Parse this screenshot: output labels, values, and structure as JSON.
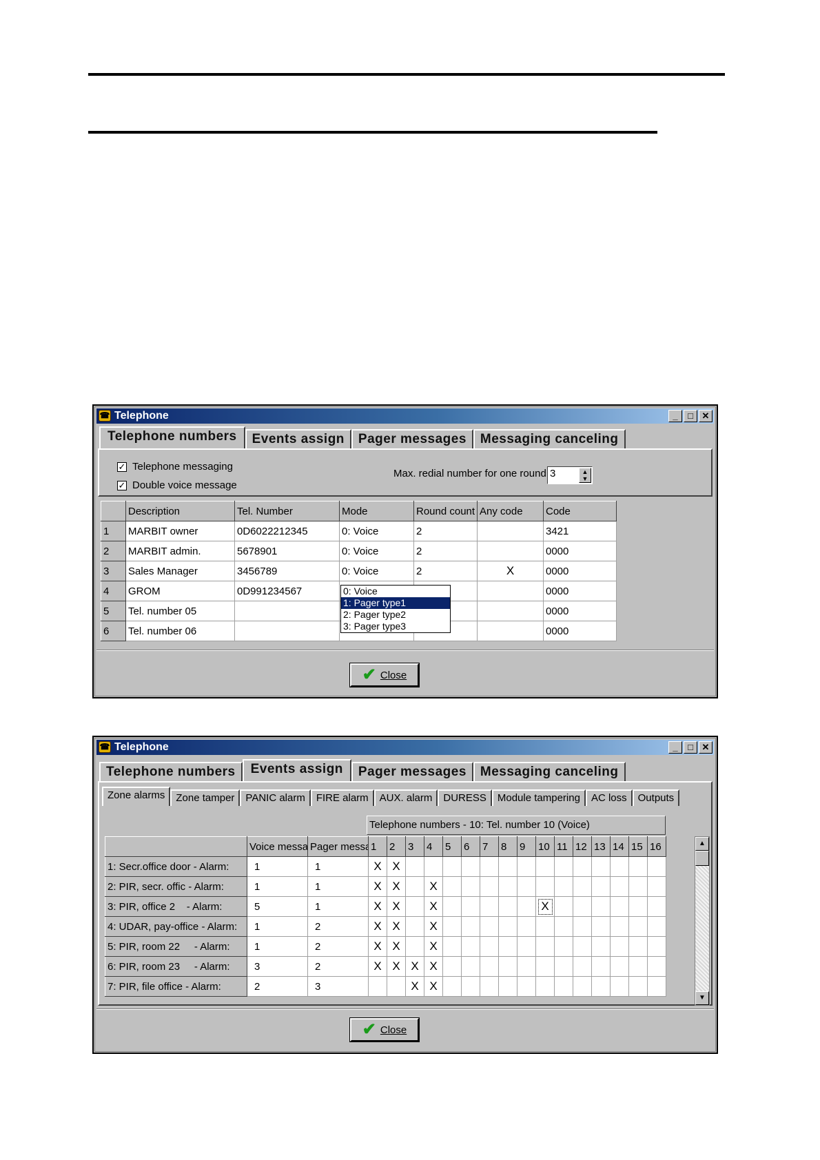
{
  "window1": {
    "title": "Telephone",
    "tabs": [
      "Telephone numbers",
      "Events assign",
      "Pager messages",
      "Messaging canceling"
    ],
    "telephone_messaging_label": "Telephone messaging",
    "double_voice_label": "Double voice message",
    "max_redial_label": "Max. redial number for one round:",
    "max_redial_value": "3",
    "columns": [
      "Description",
      "Tel. Number",
      "Mode",
      "Round count",
      "Any code",
      "Code"
    ],
    "rows": [
      {
        "num": "1",
        "description": "MARBIT owner",
        "tel": "0D6022212345",
        "mode": "0: Voice",
        "round": "2",
        "any": "",
        "code": "3421"
      },
      {
        "num": "2",
        "description": "MARBIT admin.",
        "tel": "5678901",
        "mode": "0: Voice",
        "round": "2",
        "any": "",
        "code": "0000"
      },
      {
        "num": "3",
        "description": "Sales Manager",
        "tel": "3456789",
        "mode": "0: Voice",
        "round": "2",
        "any": "X",
        "code": "0000"
      },
      {
        "num": "4",
        "description": "GROM",
        "tel": "0D991234567",
        "mode": "",
        "round": "",
        "any": "",
        "code": "0000"
      },
      {
        "num": "5",
        "description": "Tel. number 05",
        "tel": "",
        "mode": "",
        "round": "",
        "any": "",
        "code": "0000"
      },
      {
        "num": "6",
        "description": "Tel. number 06",
        "tel": "",
        "mode": "",
        "round": "",
        "any": "",
        "code": "0000"
      }
    ],
    "mode_dropdown": [
      "0: Voice",
      "1: Pager type1",
      "2: Pager type2",
      "3: Pager type3"
    ],
    "close_label": "Close"
  },
  "window2": {
    "title": "Telephone",
    "tabs": [
      "Telephone numbers",
      "Events assign",
      "Pager messages",
      "Messaging canceling"
    ],
    "subtabs": [
      "Zone alarms",
      "Zone tamper",
      "PANIC alarm",
      "FIRE alarm",
      "AUX. alarm",
      "DURESS",
      "Module tampering",
      "AC loss",
      "Outputs"
    ],
    "group_header": "Telephone numbers -  10: Tel. number 10   (Voice)",
    "columns": [
      "Voice messa",
      "Pager messa"
    ],
    "number_columns": [
      "1",
      "2",
      "3",
      "4",
      "5",
      "6",
      "7",
      "8",
      "9",
      "10",
      "11",
      "12",
      "13",
      "14",
      "15",
      "16"
    ],
    "rows": [
      {
        "label": "1: Secr.office door - Alarm:",
        "voice": "1",
        "pager": "1",
        "marks": [
          1,
          2
        ]
      },
      {
        "label": "2: PIR, secr. offic - Alarm:",
        "voice": "1",
        "pager": "1",
        "marks": [
          1,
          2,
          4
        ]
      },
      {
        "label": "3: PIR, office 2    - Alarm:",
        "voice": "5",
        "pager": "1",
        "marks": [
          1,
          2,
          4,
          10
        ]
      },
      {
        "label": "4: UDAR, pay-office - Alarm:",
        "voice": "1",
        "pager": "2",
        "marks": [
          1,
          2,
          4
        ]
      },
      {
        "label": "5: PIR, room 22     - Alarm:",
        "voice": "1",
        "pager": "2",
        "marks": [
          1,
          2,
          4
        ]
      },
      {
        "label": "6: PIR, room 23     - Alarm:",
        "voice": "3",
        "pager": "2",
        "marks": [
          1,
          2,
          3,
          4
        ]
      },
      {
        "label": "7: PIR, file office - Alarm:",
        "voice": "2",
        "pager": "3",
        "marks": [
          3,
          4
        ]
      }
    ],
    "mark_symbol": "X",
    "close_label": "Close"
  }
}
